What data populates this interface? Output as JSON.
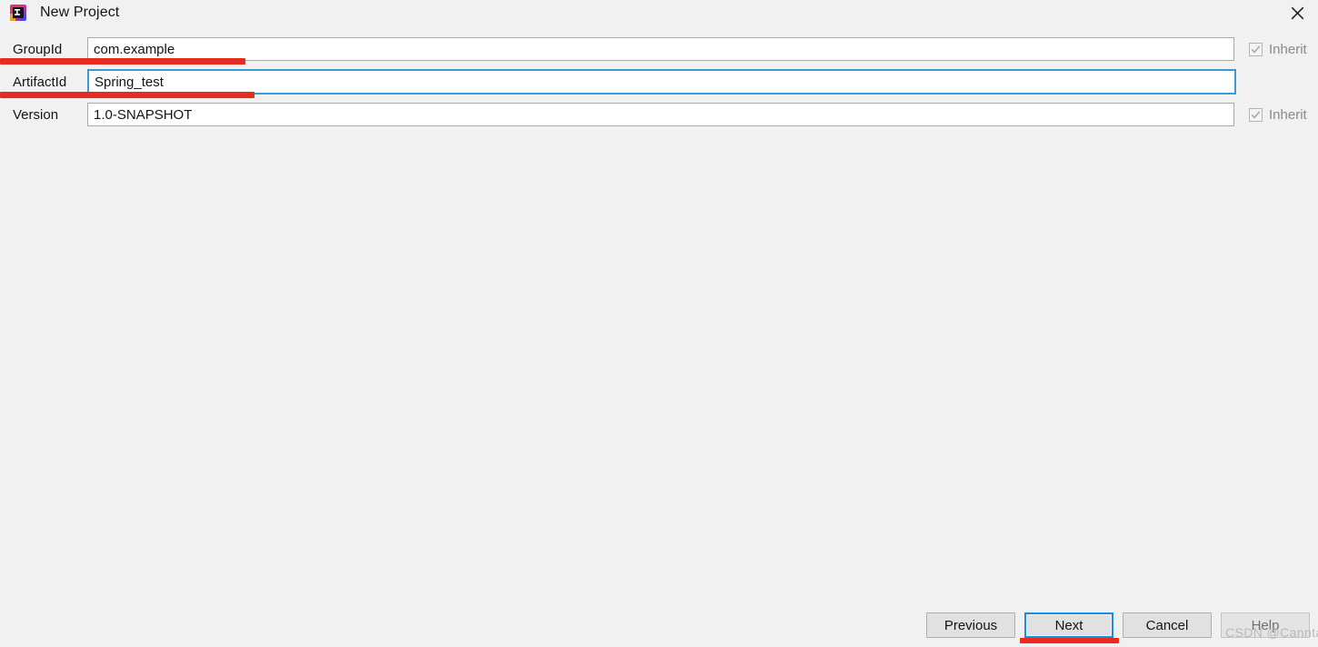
{
  "window": {
    "title": "New Project",
    "app_icon": "intellij-idea-icon",
    "close_icon": "close-icon",
    "background_color": "#f1f1f1"
  },
  "form": {
    "rows": [
      {
        "label": "GroupId",
        "value": "com.example",
        "placeholder": "",
        "focused": false,
        "inherit": {
          "label": "Inherit",
          "checked": true,
          "enabled": false
        }
      },
      {
        "label": "ArtifactId",
        "value": "Spring_test",
        "placeholder": "",
        "focused": true,
        "inherit": null
      },
      {
        "label": "Version",
        "value": "1.0-SNAPSHOT",
        "placeholder": "",
        "focused": false,
        "inherit": {
          "label": "Inherit",
          "checked": true,
          "enabled": false
        }
      }
    ]
  },
  "buttons": {
    "previous": "Previous",
    "next": "Next",
    "cancel": "Cancel",
    "help": "Help"
  },
  "annotations": {
    "color": "#e82b1f",
    "marks": [
      "underline-groupid-row",
      "underline-artifactid-row",
      "underline-next-button"
    ]
  },
  "watermark": {
    "text": "CSDN @Cannta",
    "color": "#b9b9b9"
  },
  "colors": {
    "focus_blue": "#1a8fe0",
    "input_border": "#a9a9a9",
    "button_face": "#e1e1e1",
    "disabled_text": "#8a8a8a"
  }
}
